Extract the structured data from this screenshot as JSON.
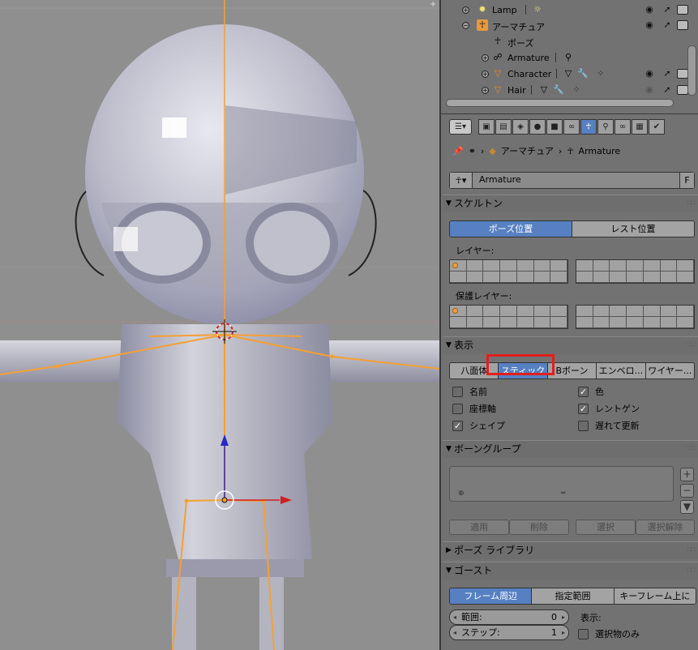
{
  "outliner": {
    "rows": [
      {
        "name": "Lamp",
        "icon": "lamp-icon"
      },
      {
        "name": "アーマチュア",
        "icon": "armature-icon"
      },
      {
        "name": "ポーズ",
        "icon": "pose-icon"
      },
      {
        "name": "Armature",
        "icon": "armature-data-icon"
      },
      {
        "name": "Character",
        "icon": "mesh-object-icon"
      },
      {
        "name": "Hair",
        "icon": "mesh-object-icon"
      }
    ]
  },
  "properties": {
    "breadcrumb": {
      "object": "アーマチュア",
      "data": "Armature"
    },
    "datablock_name": "Armature",
    "datablock_fake_user": "F",
    "skeleton": {
      "title": "スケルトン",
      "pose_position": "ポーズ位置",
      "rest_position": "レスト位置",
      "layers_label": "レイヤー:",
      "protected_layers_label": "保護レイヤー:"
    },
    "display": {
      "title": "表示",
      "options": [
        "八面体",
        "スティック",
        "Bボーン",
        "エンベロ...",
        "ワイヤー..."
      ],
      "selected": "スティック",
      "names": "名前",
      "axes": "座標軸",
      "shapes": "シェイプ",
      "colors": "色",
      "xray": "レントゲン",
      "delay_refresh": "遅れて更新"
    },
    "bone_groups": {
      "title": "ボーングループ",
      "assign": "適用",
      "remove": "削除",
      "select": "選択",
      "deselect": "選択解除"
    },
    "pose_library": {
      "title": "ポーズ ライブラリ"
    },
    "ghost": {
      "title": "ゴースト",
      "around_frame": "フレーム周辺",
      "in_range": "指定範囲",
      "on_keyframes": "キーフレーム上に",
      "range_label": "範囲:",
      "range_value": "0",
      "step_label": "ステップ:",
      "step_value": "1",
      "display_label": "表示:",
      "selected_only": "選択物のみ"
    }
  },
  "colors": {
    "accent_blue": "#5680c2",
    "bone_orange": "#f5a033",
    "highlight_red": "#e41e1e"
  }
}
